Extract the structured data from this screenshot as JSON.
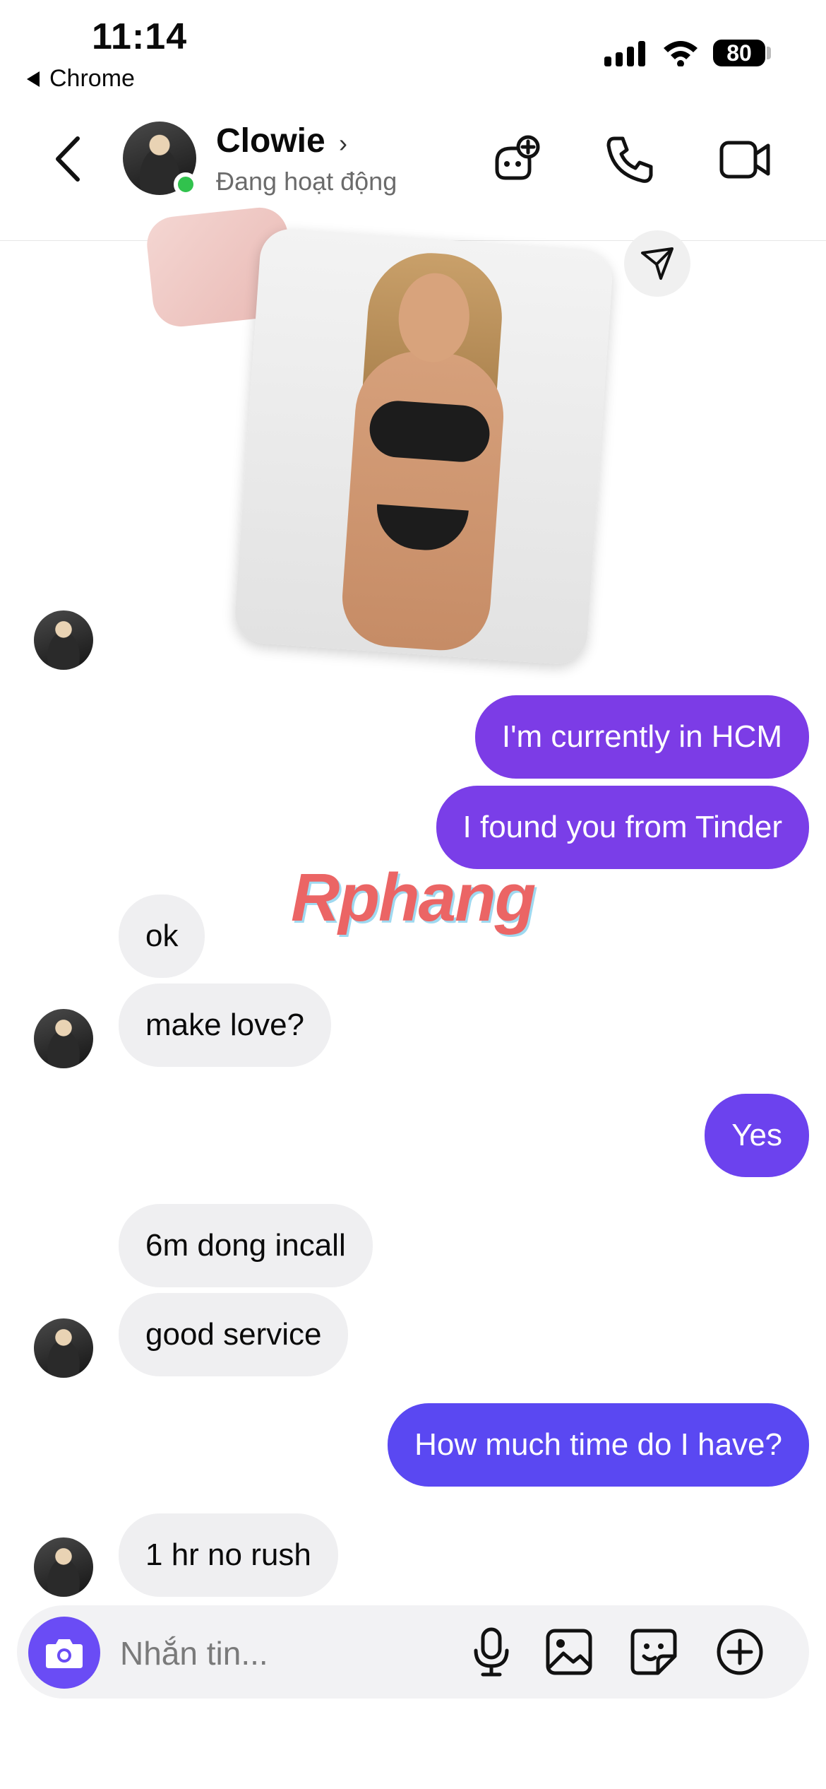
{
  "status_bar": {
    "time": "11:14",
    "back_app": "Chrome",
    "battery": "80"
  },
  "header": {
    "contact_name": "Clowie",
    "contact_status": "Đang hoạt động",
    "icons": [
      "back-icon",
      "games-icon",
      "phone-icon",
      "video-camera-icon"
    ]
  },
  "messages": [
    {
      "side": "out",
      "text": "I'm currently in HCM",
      "color": "#7c3ce6"
    },
    {
      "side": "out",
      "text": "I found you from Tinder",
      "color": "#7a3ee8"
    },
    {
      "side": "in",
      "text": "ok"
    },
    {
      "side": "in",
      "text": "make love?"
    },
    {
      "side": "out",
      "text": "Yes",
      "color": "#6c42ee"
    },
    {
      "side": "in",
      "text": "6m dong incall"
    },
    {
      "side": "in",
      "text": "good service"
    },
    {
      "side": "out",
      "text": "How much time do I have?",
      "color": "#5a48f2"
    },
    {
      "side": "in",
      "text": "1 hr no rush"
    }
  ],
  "watermark": "Rphang",
  "composer": {
    "placeholder": "Nhắn tin..."
  },
  "colors": {
    "accent": "#6a4cf5",
    "online": "#31c24d",
    "incoming_bubble": "#efeff1"
  }
}
